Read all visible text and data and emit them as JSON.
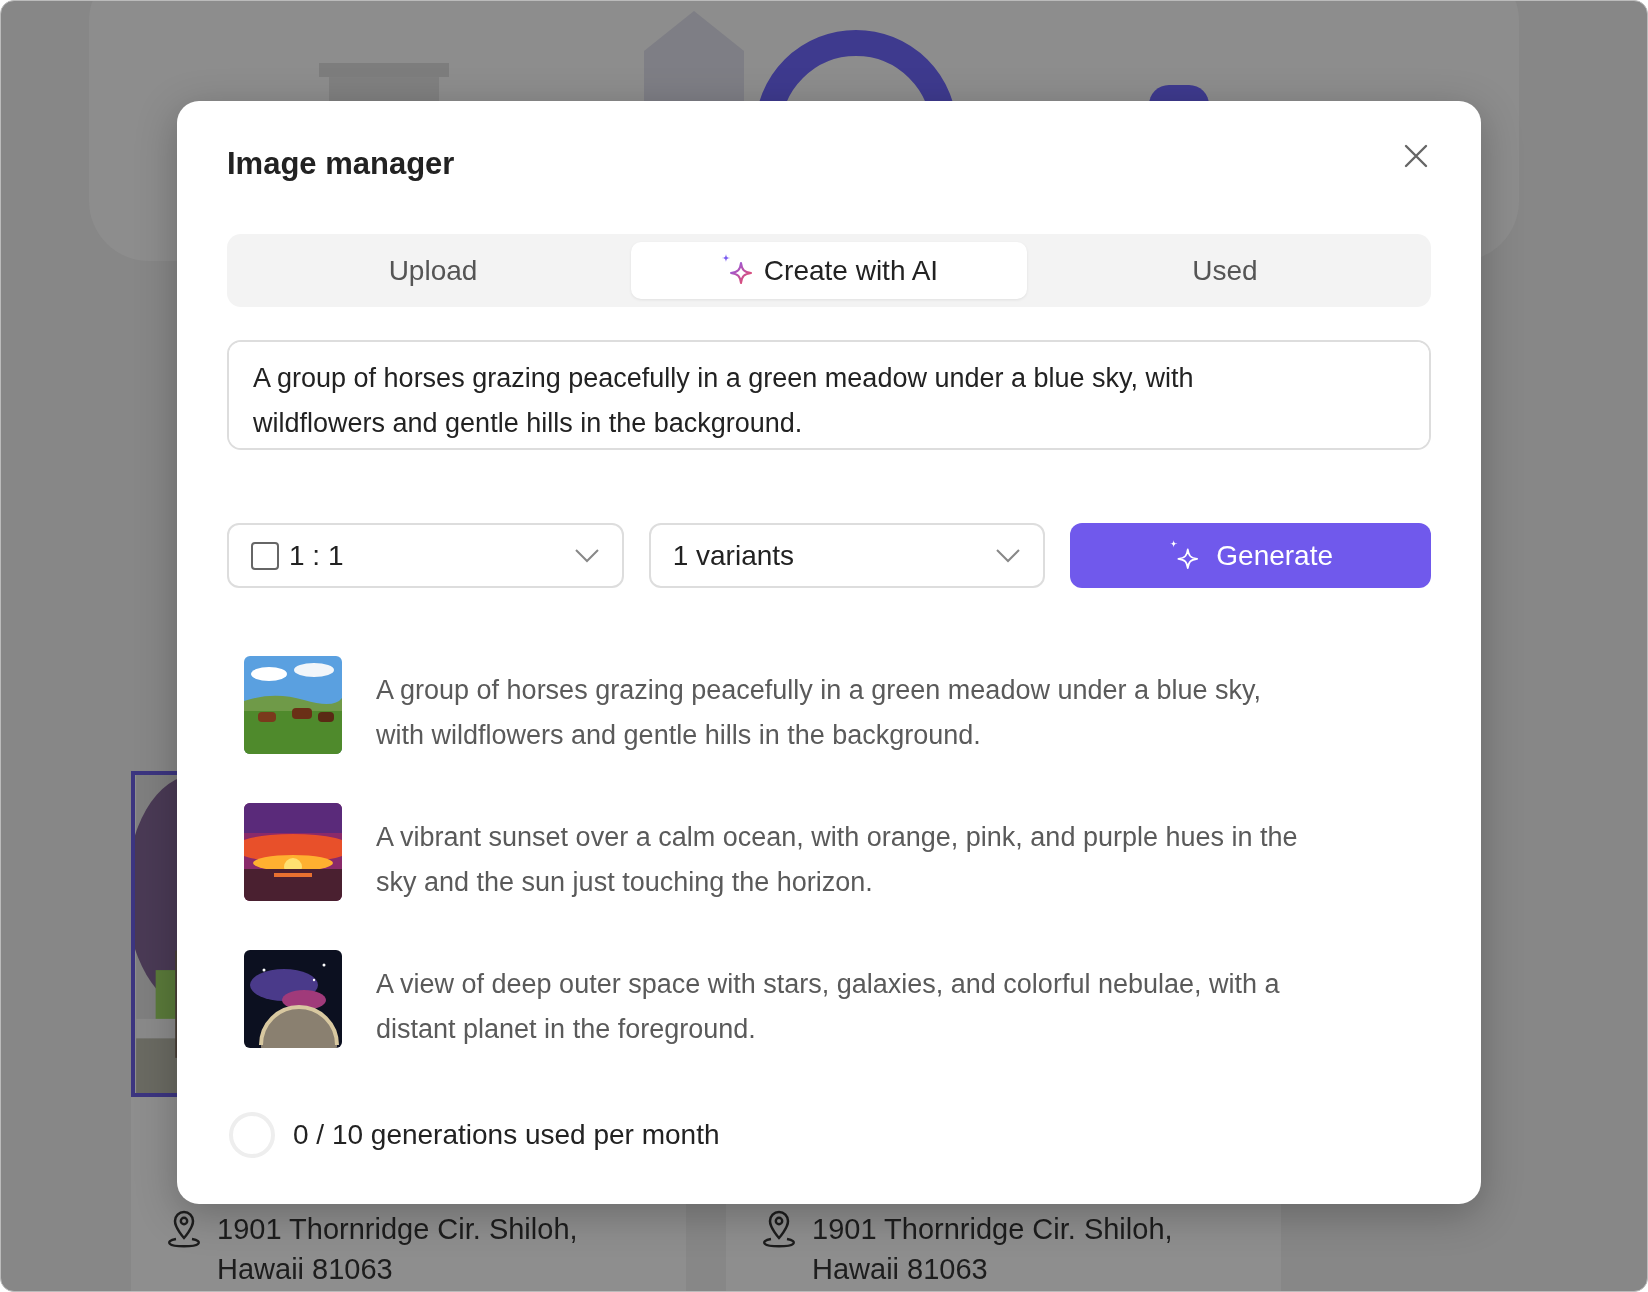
{
  "dialog": {
    "title": "Image manager"
  },
  "tabs": [
    {
      "label": "Upload",
      "selected": false,
      "kind": "plain"
    },
    {
      "label": "Create with AI",
      "selected": true,
      "kind": "ai"
    },
    {
      "label": "Used",
      "selected": false,
      "kind": "plain"
    }
  ],
  "prompt": {
    "value": "A group of horses grazing peacefully in a green meadow under a blue sky, with wildflowers and gentle hills in the background."
  },
  "aspect_select": {
    "value": "1 : 1",
    "checked": false
  },
  "variants_select": {
    "value": "1 variants"
  },
  "generate_button": {
    "label": "Generate"
  },
  "history": [
    {
      "kind": "picture",
      "prompt": "A group of horses grazing peacefully in a green meadow under a blue sky, with wildflowers and gentle hills in the background."
    },
    {
      "kind": "picture",
      "prompt": "A vibrant sunset over a calm ocean, with orange, pink, and purple hues in the sky and the sun just touching the horizon."
    },
    {
      "kind": "picture",
      "prompt": "A view of deep outer space with stars, galaxies, and colorful nebulae, with a distant planet in the foreground."
    }
  ],
  "usage": {
    "text": "0 / 10 generations used per month",
    "level": 0
  },
  "background": {
    "listings": [
      {
        "address_line1": "1901 Thornridge Cir. Shiloh,",
        "address_line2": "Hawaii 81063"
      },
      {
        "address_line1": "1901 Thornridge Cir. Shiloh,",
        "address_line2": "Hawaii 81063"
      }
    ]
  }
}
